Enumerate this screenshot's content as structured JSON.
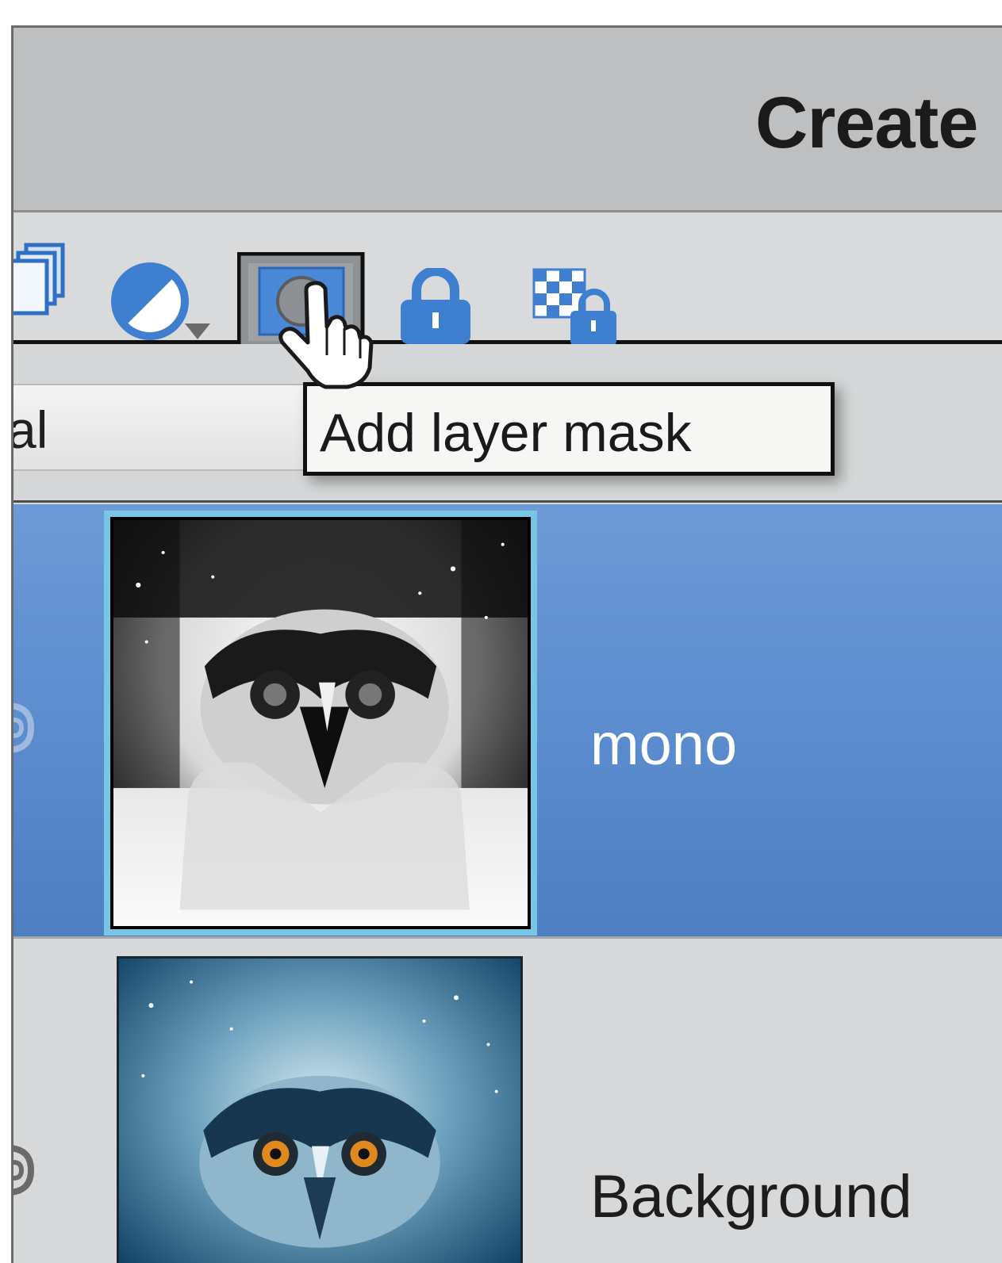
{
  "header": {
    "title": "Create"
  },
  "toolbar": {
    "tools": [
      {
        "name": "stack-layers-icon"
      },
      {
        "name": "adjustment-layer-icon"
      },
      {
        "name": "add-layer-mask-icon",
        "active": true
      },
      {
        "name": "lock-all-icon"
      },
      {
        "name": "lock-transparency-icon"
      }
    ]
  },
  "blend_mode": {
    "value": "al"
  },
  "tooltip": {
    "text": "Add layer mask"
  },
  "layers": [
    {
      "name": "mono",
      "selected": true
    },
    {
      "name": "Background",
      "selected": false
    }
  ],
  "colors": {
    "accent_selected": "#5d8ed0",
    "thumb_highlight": "#78c6e4",
    "icon_blue": "#3f7fd0"
  }
}
